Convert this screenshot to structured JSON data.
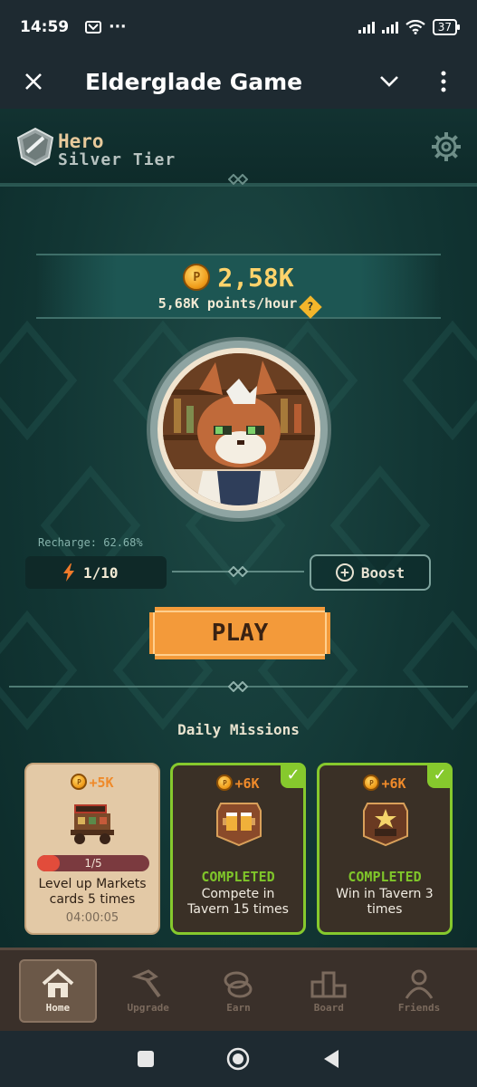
{
  "status_bar": {
    "time": "14:59",
    "battery": "37",
    "icons": [
      "notification-icon",
      "more-dots-icon",
      "signal-icon",
      "signal-icon",
      "wifi-icon",
      "battery-icon"
    ]
  },
  "app_bar": {
    "title": "Elderglade Game",
    "icons": [
      "close-icon",
      "chevron-down-icon",
      "more-vert-icon"
    ]
  },
  "hero": {
    "name": "Hero",
    "tier": "Silver Tier"
  },
  "points": {
    "total": "2,58K",
    "rate": "5,68K points/hour",
    "help_glyph": "?"
  },
  "energy": {
    "recharge_label": "Recharge: 62.68%",
    "value": "1/10",
    "boost_label": "Boost"
  },
  "play_label": "PLAY",
  "missions": {
    "title": "Daily Missions",
    "items": [
      {
        "reward": "+5K",
        "progress_text": "1/5",
        "progress": 0.2,
        "description": "Level up Markets cards 5 times",
        "timer": "04:00:05",
        "icon": "market-cart-icon"
      },
      {
        "reward": "+6K",
        "status": "COMPLETED",
        "description": "Compete in Tavern 15 times",
        "icon": "tavern-mugs-icon"
      },
      {
        "reward": "+6K",
        "status": "COMPLETED",
        "description": "Win in Tavern 3 times",
        "icon": "tavern-win-icon"
      }
    ]
  },
  "nav": {
    "items": [
      {
        "label": "Home",
        "icon": "home-icon"
      },
      {
        "label": "Upgrade",
        "icon": "hammer-icon"
      },
      {
        "label": "Earn",
        "icon": "coins-icon"
      },
      {
        "label": "Board",
        "icon": "podium-icon"
      },
      {
        "label": "Friends",
        "icon": "friends-icon"
      }
    ]
  },
  "colors": {
    "background": "#123634",
    "accent": "#f39a3a",
    "gold": "#ffd36b",
    "complete": "#86c92d"
  }
}
